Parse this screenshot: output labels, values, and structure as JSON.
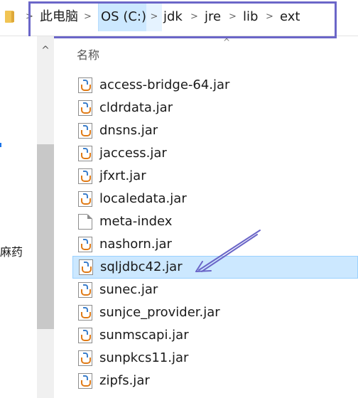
{
  "address_bar": {
    "crumbs": [
      "此电脑",
      "OS (C:)",
      "jdk",
      "jre",
      "lib",
      "ext"
    ],
    "separator": ">",
    "icon": "folder-icon"
  },
  "left_pane": {
    "partial_label": "麻药"
  },
  "column_header": {
    "name": "名称",
    "sort_indicator": "^"
  },
  "scrollbar": {
    "up_arrow": "^"
  },
  "files": [
    {
      "name": "access-bridge-64.jar",
      "type": "jar"
    },
    {
      "name": "cldrdata.jar",
      "type": "jar"
    },
    {
      "name": "dnsns.jar",
      "type": "jar"
    },
    {
      "name": "jaccess.jar",
      "type": "jar"
    },
    {
      "name": "jfxrt.jar",
      "type": "jar"
    },
    {
      "name": "localedata.jar",
      "type": "jar"
    },
    {
      "name": "meta-index",
      "type": "file"
    },
    {
      "name": "nashorn.jar",
      "type": "jar"
    },
    {
      "name": "sqljdbc42.jar",
      "type": "jar",
      "selected": true
    },
    {
      "name": "sunec.jar",
      "type": "jar"
    },
    {
      "name": "sunjce_provider.jar",
      "type": "jar"
    },
    {
      "name": "sunmscapi.jar",
      "type": "jar"
    },
    {
      "name": "sunpkcs11.jar",
      "type": "jar"
    },
    {
      "name": "zipfs.jar",
      "type": "jar"
    }
  ],
  "colors": {
    "selection": "#cce8ff",
    "annotation": "#6b66c8"
  }
}
